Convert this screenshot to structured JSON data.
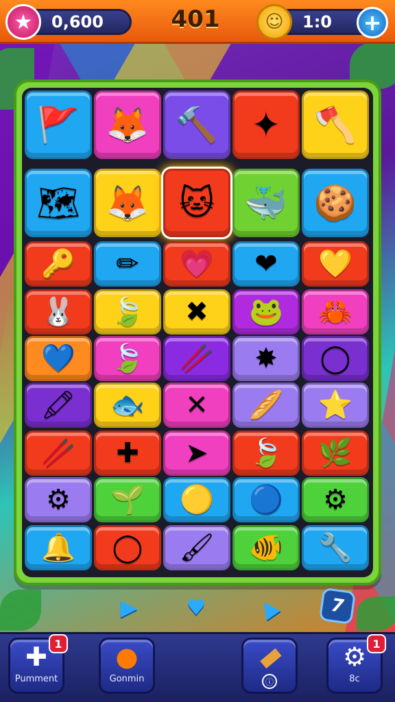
{
  "header": {
    "score": "0,600",
    "level": "401",
    "coins": "1:0"
  },
  "board": {
    "top_rows": [
      [
        {
          "icon": "flag-chest",
          "glyph": "🚩",
          "color": "#1fa7f2"
        },
        {
          "icon": "pink-fox",
          "glyph": "🦊",
          "color": "#f03fbf"
        },
        {
          "icon": "golden-hammer",
          "glyph": "🔨",
          "color": "#7b4de8"
        },
        {
          "icon": "green-shuriken",
          "glyph": "✦",
          "color": "#f23a1d"
        },
        {
          "icon": "silver-axe",
          "glyph": "🪓",
          "color": "#ffd21a"
        }
      ],
      [
        {
          "icon": "treasure-map",
          "glyph": "🗺",
          "color": "#1fa7f2"
        },
        {
          "icon": "orange-fox",
          "glyph": "🦊",
          "color": "#ffd21a"
        },
        {
          "icon": "blue-cat-crossbones",
          "glyph": "🐱",
          "color": "#f23a1d",
          "selected": true
        },
        {
          "icon": "pink-whale",
          "glyph": "🐳",
          "color": "#6fd132"
        },
        {
          "icon": "cookie-shield",
          "glyph": "🍪",
          "color": "#1fa7f2"
        }
      ]
    ],
    "rows": [
      [
        {
          "icon": "key",
          "glyph": "🔑",
          "color": "#f23a1d"
        },
        {
          "icon": "pencil",
          "glyph": "✏",
          "color": "#1fa7f2"
        },
        {
          "icon": "heart-slider",
          "glyph": "💗",
          "color": "#f23a1d"
        },
        {
          "icon": "red-heart",
          "glyph": "❤",
          "color": "#1fa7f2"
        },
        {
          "icon": "yellow-drop",
          "glyph": "💛",
          "color": "#f23a1d"
        }
      ],
      [
        {
          "icon": "blue-bunny",
          "glyph": "🐰",
          "color": "#f23a1d"
        },
        {
          "icon": "green-leaf",
          "glyph": "🍃",
          "color": "#ffd21a"
        },
        {
          "icon": "wood-cross",
          "glyph": "✖",
          "color": "#ffd21a"
        },
        {
          "icon": "green-frog",
          "glyph": "🐸",
          "color": "#b02ae0"
        },
        {
          "icon": "teal-crab",
          "glyph": "🦀",
          "color": "#f03fbf"
        }
      ],
      [
        {
          "icon": "blue-heart",
          "glyph": "💙",
          "color": "#ff8a1f"
        },
        {
          "icon": "leaf",
          "glyph": "🍃",
          "color": "#f03fbf"
        },
        {
          "icon": "orange-stick",
          "glyph": "🥢",
          "color": "#8a2be2"
        },
        {
          "icon": "orange-star",
          "glyph": "✸",
          "color": "#9b7cf0"
        },
        {
          "icon": "orange-ring",
          "glyph": "◯",
          "color": "#7a2fd0"
        }
      ],
      [
        {
          "icon": "red-crayon",
          "glyph": "🖍",
          "color": "#7a2fd0"
        },
        {
          "icon": "red-fish",
          "glyph": "🐟",
          "color": "#ffd21a"
        },
        {
          "icon": "purple-x",
          "glyph": "✕",
          "color": "#f03fbf"
        },
        {
          "icon": "bread-stick",
          "glyph": "🥖",
          "color": "#9b7cf0"
        },
        {
          "icon": "blue-starfish",
          "glyph": "⭐",
          "color": "#9b7cf0"
        }
      ],
      [
        {
          "icon": "yellow-bar",
          "glyph": "🥢",
          "color": "#f23a1d"
        },
        {
          "icon": "green-cross",
          "glyph": "✚",
          "color": "#f23a1d"
        },
        {
          "icon": "blue-arrow",
          "glyph": "➤",
          "color": "#f03fbf"
        },
        {
          "icon": "green-leaf",
          "glyph": "🍃",
          "color": "#f23a1d"
        },
        {
          "icon": "teal-leaf",
          "glyph": "🌿",
          "color": "#f23a1d"
        }
      ],
      [
        {
          "icon": "orange-gear",
          "glyph": "⚙",
          "color": "#9b7cf0"
        },
        {
          "icon": "red-plant",
          "glyph": "🌱",
          "color": "#4ed13a"
        },
        {
          "icon": "yellow-blob",
          "glyph": "🟡",
          "color": "#1fa7f2"
        },
        {
          "icon": "blue-orb",
          "glyph": "🔵",
          "color": "#1fa7f2"
        },
        {
          "icon": "yellow-gear",
          "glyph": "⚙",
          "color": "#4ed13a"
        }
      ],
      [
        {
          "icon": "golden-bell",
          "glyph": "🔔",
          "color": "#1fa7f2"
        },
        {
          "icon": "blue-ring",
          "glyph": "◯",
          "color": "#f23a1d"
        },
        {
          "icon": "fork-brush",
          "glyph": "🖌",
          "color": "#9b7cf0"
        },
        {
          "icon": "orange-fish",
          "glyph": "🐠",
          "color": "#4ed13a"
        },
        {
          "icon": "silver-tool",
          "glyph": "🔧",
          "color": "#1fa7f2"
        }
      ]
    ]
  },
  "hints": {
    "moves": "7"
  },
  "boosters": [
    {
      "label": "Pumment",
      "badge": "1"
    },
    {
      "label": "Gonmin"
    },
    {
      "label": ""
    },
    {
      "label": "8c",
      "badge": "1"
    }
  ]
}
